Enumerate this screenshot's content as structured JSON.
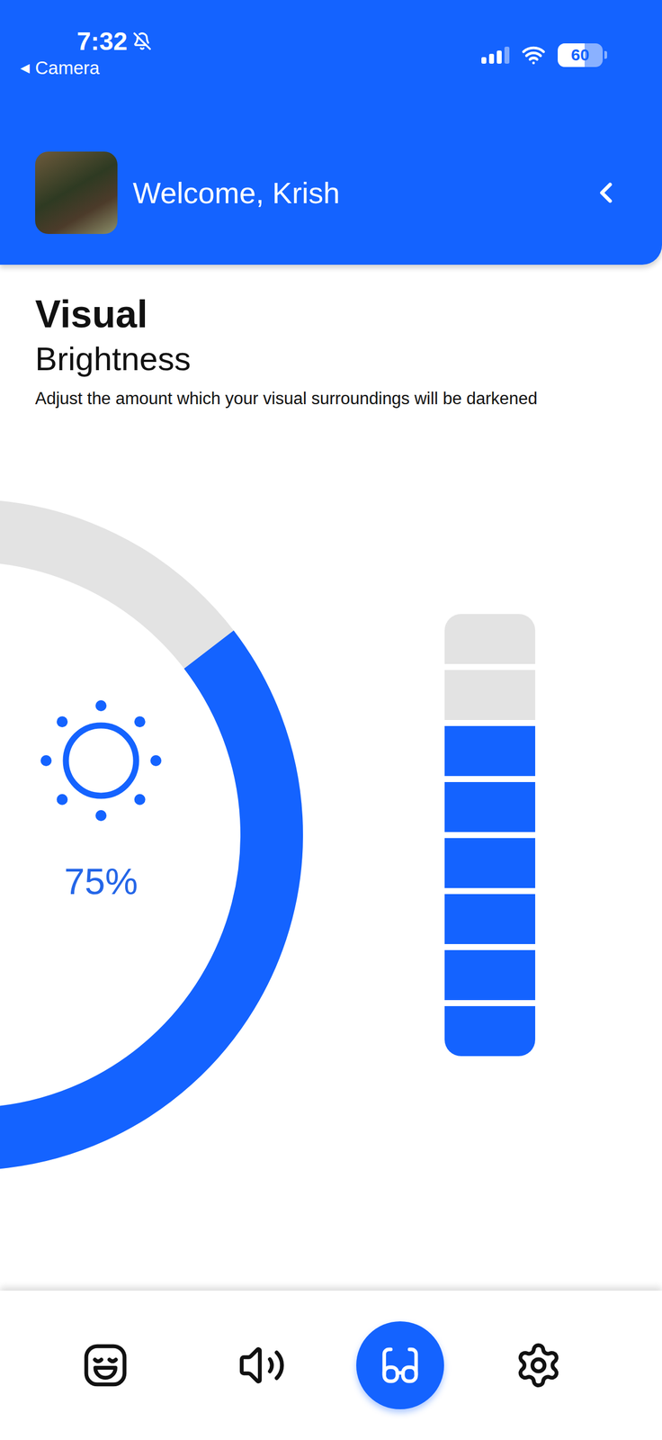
{
  "status_bar": {
    "time": "7:32",
    "silent": true,
    "back_glyph": "◀",
    "back_label": "Camera",
    "signal": {
      "level": 0.75
    },
    "battery": {
      "reading": "60",
      "level": 0.6
    }
  },
  "header": {
    "greeting": "Welcome, Krish"
  },
  "section": {
    "title": "Visual",
    "subtitle": "Brightness",
    "description": "Adjust the amount which your visual surroundings will be darkened"
  },
  "brightness": {
    "reading": "75%",
    "level": 0.75
  },
  "level_bar": {
    "segments": [
      {
        "filled": false
      },
      {
        "filled": false
      },
      {
        "filled": true
      },
      {
        "filled": true
      },
      {
        "filled": true
      },
      {
        "filled": true
      },
      {
        "filled": true
      },
      {
        "filled": true
      }
    ]
  },
  "nav": [
    {
      "kind": "mood",
      "selected": false
    },
    {
      "kind": "sound",
      "selected": false
    },
    {
      "kind": "visual",
      "selected": true
    },
    {
      "kind": "settings",
      "selected": false
    }
  ]
}
